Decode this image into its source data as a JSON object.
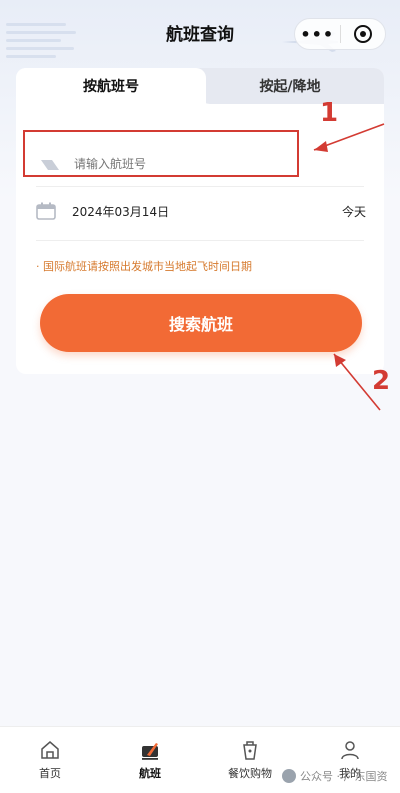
{
  "nav": {
    "title": "航班查询",
    "more_glyph": "•••"
  },
  "tabs": [
    {
      "label": "按航班号",
      "active": true
    },
    {
      "label": "按起/降地",
      "active": false
    }
  ],
  "form": {
    "flight_input_placeholder": "请输入航班号",
    "date_value": "2024年03月14日",
    "date_tag": "今天",
    "note": "· 国际航班请按照出发城市当地起飞时间日期",
    "search_label": "搜索航班"
  },
  "annotations": {
    "marker_1": "1",
    "marker_2": "2",
    "color": "#d33b33"
  },
  "tabbar": [
    {
      "label": "首页",
      "icon": "home-icon",
      "active": false
    },
    {
      "label": "航班",
      "icon": "flight-icon",
      "active": true
    },
    {
      "label": "餐饮购物",
      "icon": "dining-shopping-icon",
      "active": false
    },
    {
      "label": "我的",
      "icon": "profile-icon",
      "active": false
    }
  ],
  "watermark": {
    "text": "公众号 · 广东国资"
  },
  "colors": {
    "accent": "#f26a35",
    "note": "#d67a2e",
    "annotation": "#d33b33"
  }
}
